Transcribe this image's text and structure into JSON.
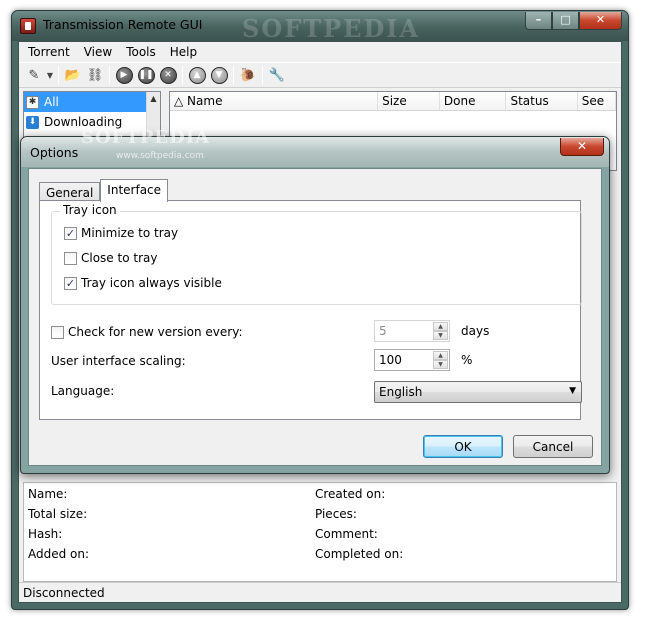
{
  "main": {
    "title": "Transmission Remote GUI",
    "watermark": "SOFTPEDIA",
    "menu": [
      "Torrent",
      "View",
      "Tools",
      "Help"
    ],
    "filters": [
      {
        "label": "All",
        "icon": "asterisk-icon",
        "selected": true
      },
      {
        "label": "Downloading",
        "icon": "download-arrow-icon",
        "selected": false
      }
    ],
    "columns": [
      "Name",
      "Size",
      "Done",
      "Status",
      "See"
    ],
    "details": {
      "left": [
        "Name:",
        "Total size:",
        "Hash:",
        "Added on:"
      ],
      "right": [
        "Created on:",
        "Pieces:",
        "Comment:",
        "Completed on:"
      ]
    },
    "status": "Disconnected"
  },
  "dialog": {
    "title": "Options",
    "watermark": "SOFTPEDIA",
    "watermark_url": "www.softpedia.com",
    "tabs": [
      "General",
      "Interface"
    ],
    "active_tab": "Interface",
    "tray_group": {
      "label": "Tray icon",
      "options": [
        {
          "label": "Minimize to tray",
          "checked": true
        },
        {
          "label": "Close to tray",
          "checked": false
        },
        {
          "label": "Tray icon always visible",
          "checked": true
        }
      ]
    },
    "check_version": {
      "label": "Check for new version every:",
      "checked": false,
      "value": "5",
      "unit": "days"
    },
    "scaling": {
      "label": "User interface scaling:",
      "value": "100",
      "unit": "%"
    },
    "language": {
      "label": "Language:",
      "value": "English"
    },
    "ok_label": "OK",
    "cancel_label": "Cancel"
  },
  "colors": {
    "accent": "#3399ff",
    "glass": "#85a3a0",
    "close_button": "#c8472e"
  }
}
